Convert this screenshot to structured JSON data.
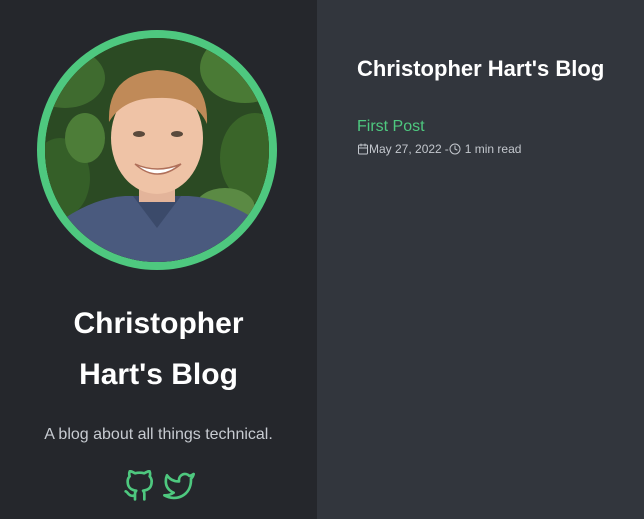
{
  "sidebar": {
    "title_line1": "Christopher",
    "title_line2": "Hart's Blog",
    "tagline": "A blog about all things technical.",
    "social_links": [
      {
        "icon": "github-icon"
      },
      {
        "icon": "twitter-icon"
      }
    ]
  },
  "main": {
    "title": "Christopher Hart's Blog",
    "posts": [
      {
        "title": "First Post",
        "date": "May 27, 2022",
        "separator": "-",
        "read_time": "1 min read",
        "date_icon": "calendar-icon",
        "time_icon": "clock-icon"
      }
    ]
  },
  "colors": {
    "accent": "#4ec87f",
    "sidebar_bg": "#25272c",
    "main_bg": "#32363d",
    "text_primary": "#ffffff",
    "text_secondary": "#c7cbd1"
  }
}
